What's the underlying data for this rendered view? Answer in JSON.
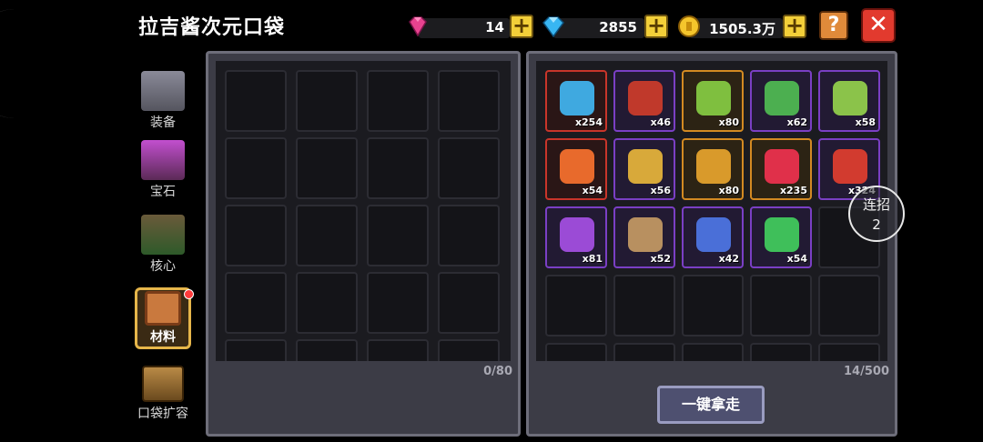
{
  "title": "拉吉酱次元口袋",
  "currencies": {
    "pink_gem": {
      "value": "14",
      "icon": "pink-gem-icon"
    },
    "blue_gem": {
      "value": "2855",
      "icon": "blue-diamond-icon"
    },
    "gold": {
      "value": "1505.3万",
      "icon": "gold-coin-icon"
    }
  },
  "help_label": "?",
  "close_label": "✕",
  "plus_label": "+",
  "sidebar": [
    {
      "label": "装备",
      "icon": "armor-icon"
    },
    {
      "label": "宝石",
      "icon": "gem-crystal-icon"
    },
    {
      "label": "核心",
      "icon": "core-icon"
    },
    {
      "label": "材料",
      "icon": "materials-book-icon",
      "active": true
    },
    {
      "label": "口袋扩容",
      "icon": "treasure-chest-icon"
    }
  ],
  "left_panel": {
    "count": "0/80"
  },
  "right_panel": {
    "count": "14/500",
    "items": [
      {
        "name": "blue-orb-material",
        "count": "x254",
        "quality": "red"
      },
      {
        "name": "red-jelly-material",
        "count": "x46",
        "quality": "purple"
      },
      {
        "name": "green-leaf-material",
        "count": "x80",
        "quality": "orange"
      },
      {
        "name": "green-gun-material",
        "count": "x62",
        "quality": "purple"
      },
      {
        "name": "plant-pot-material",
        "count": "x58",
        "quality": "purple"
      },
      {
        "name": "fire-ore-material",
        "count": "x54",
        "quality": "red"
      },
      {
        "name": "bell-material",
        "count": "x56",
        "quality": "purple"
      },
      {
        "name": "pickaxe-material",
        "count": "x80",
        "quality": "orange"
      },
      {
        "name": "red-crystal-material",
        "count": "x235",
        "quality": "orange"
      },
      {
        "name": "red-talisman-material",
        "count": "x324",
        "quality": "purple"
      },
      {
        "name": "purple-seal-material",
        "count": "x81",
        "quality": "purple"
      },
      {
        "name": "horn-material",
        "count": "x52",
        "quality": "purple"
      },
      {
        "name": "blue-wrench-material",
        "count": "x42",
        "quality": "purple"
      },
      {
        "name": "green-slime-material",
        "count": "x54",
        "quality": "purple"
      }
    ]
  },
  "take_all_label": "一键拿走",
  "combo": {
    "label": "连招",
    "value": "2"
  },
  "colors": {
    "red_quality": "#c8352a",
    "purple_quality": "#7a3fc4",
    "orange_quality": "#d38a22",
    "plus": "#f3cf39"
  }
}
